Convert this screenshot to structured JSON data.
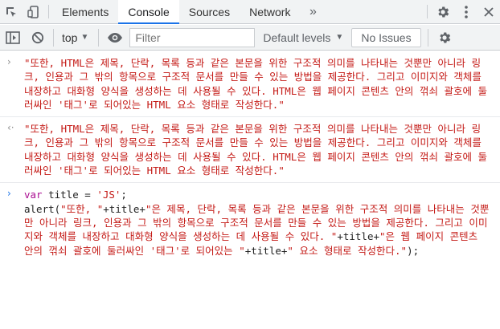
{
  "devtools": {
    "tabs": [
      "Elements",
      "Console",
      "Sources",
      "Network"
    ],
    "active_tab": "Console",
    "more_tabs": "»"
  },
  "toolbar": {
    "context": "top",
    "filter_placeholder": "Filter",
    "levels": "Default levels",
    "issues": "No Issues"
  },
  "console": {
    "entries": [
      {
        "type": "input",
        "prompt": "›",
        "text": "\"또한, HTML은 제목, 단락, 목록 등과 같은 본문을 위한 구조적 의미를 나타내는 것뿐만 아니라 링크, 인용과 그 밖의 항목으로 구조적 문서를 만들 수 있는 방법을 제공한다. 그리고 이미지와 객체를 내장하고 대화형 양식을 생성하는 데 사용될 수 있다. HTML은 웹 페이지 콘텐츠 안의 꺾쇠 괄호에 둘러싸인 '태그'로 되어있는 HTML 요소 형태로 작성한다.\""
      },
      {
        "type": "output",
        "prompt": "‹·",
        "text": "\"또한, HTML은 제목, 단락, 목록 등과 같은 본문을 위한 구조적 의미를 나타내는 것뿐만 아니라 링크, 인용과 그 밖의 항목으로 구조적 문서를 만들 수 있는 방법을 제공한다. 그리고 이미지와 객체를 내장하고 대화형 양식을 생성하는 데 사용될 수 있다. HTML은 웹 페이지 콘텐츠 안의 꺾쇠 괄호에 둘러싸인 '태그'로 되어있는 HTML 요소 형태로 작성한다.\""
      },
      {
        "type": "prompt",
        "prompt": "›",
        "line1_kw": "var",
        "line1_rest": " title = ",
        "line1_str": "'JS'",
        "line1_end": ";",
        "line2_fn": "alert(",
        "line2_str1": "\"또한, \"",
        "line2_plus1": "+title+",
        "line2_str2": "\"은 제목, 단락, 목록 등과 같은 본문을 위한 구조적 의미를 나타내는 것뿐만 아니라 링크, 인용과 그 밖의 항목으로 구조적 문서를 만들 수 있는 방법을 제공한다. 그리고 이미지와 객체를 내장하고 대화형 양식을 생성하는 데 사용될 수 있다. \"",
        "line2_plus2": "+title+",
        "line2_str3": "\"은 웹 페이지 콘텐츠 안의 꺾쇠 괄호에 둘러싸인 '태그'로 되어있는 \"",
        "line2_plus3": "+title+",
        "line2_str4": "\" 요소 형태로 작성한다.\"",
        "line2_end": ");"
      }
    ]
  }
}
